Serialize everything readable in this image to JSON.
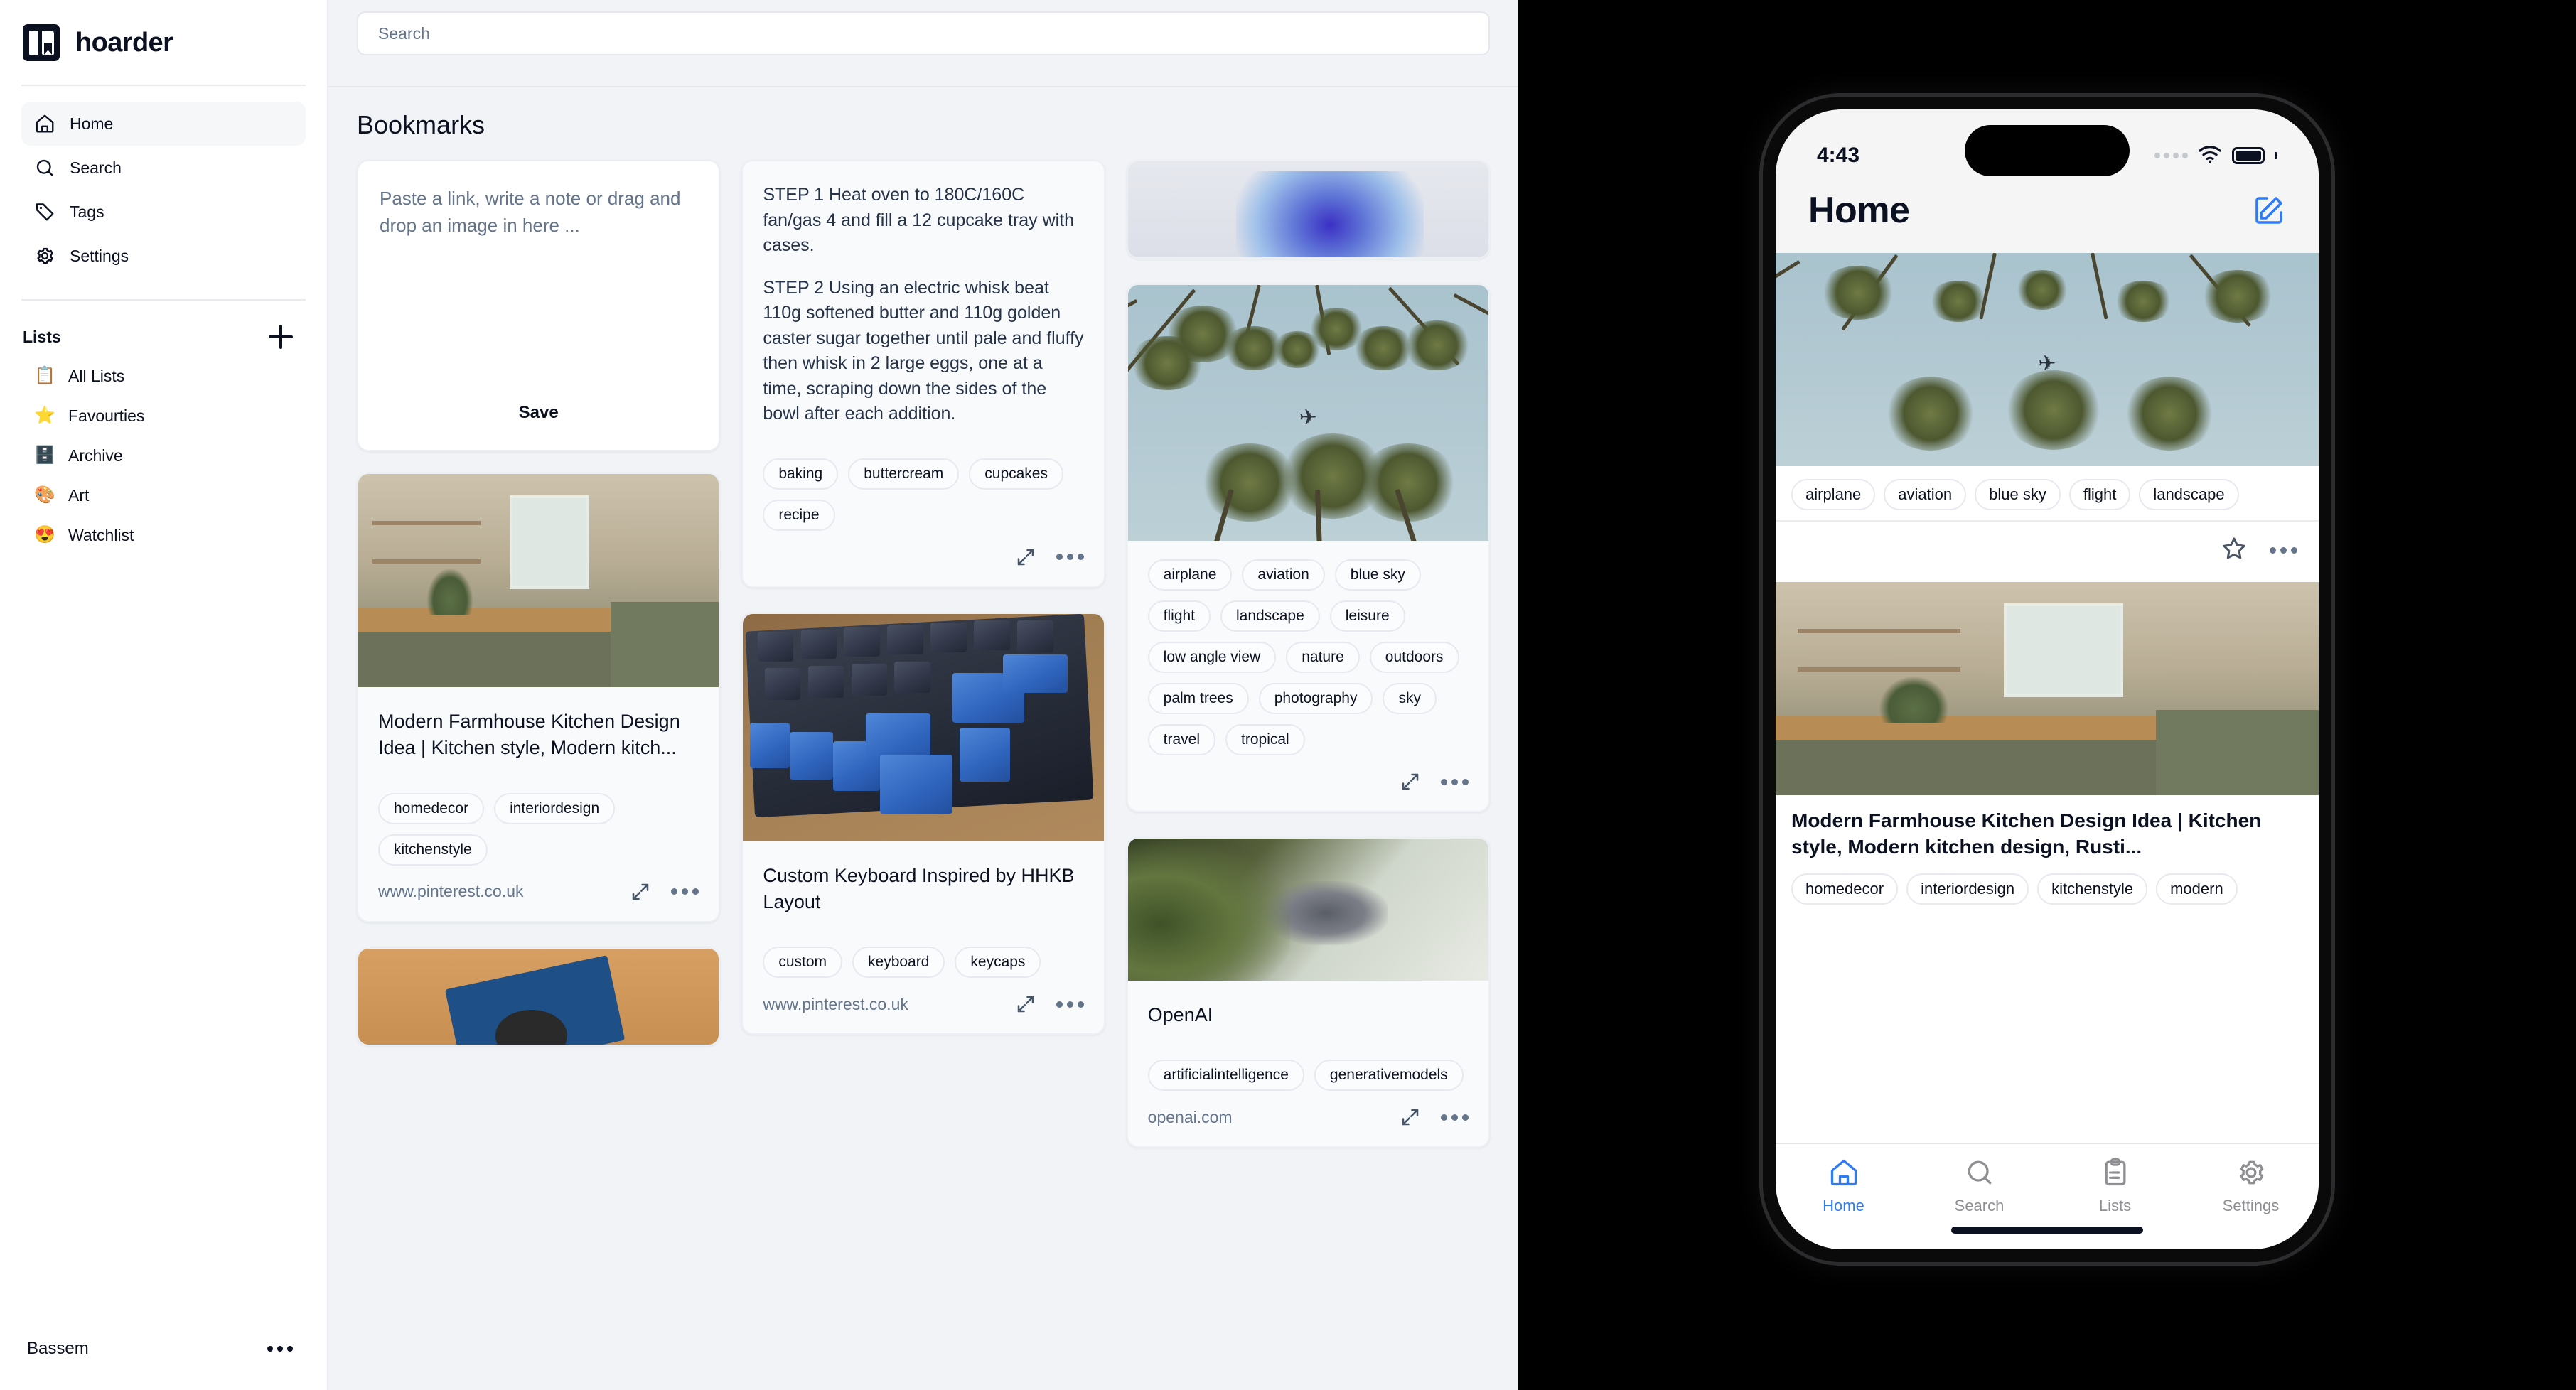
{
  "app": {
    "brand_name": "hoarder",
    "user_name": "Bassem"
  },
  "sidebar": {
    "nav": [
      {
        "label": "Home",
        "icon": "home-icon",
        "active": true
      },
      {
        "label": "Search",
        "icon": "search-icon",
        "active": false
      },
      {
        "label": "Tags",
        "icon": "tag-icon",
        "active": false
      },
      {
        "label": "Settings",
        "icon": "gear-icon",
        "active": false
      }
    ],
    "lists_title": "Lists",
    "add_list_label": "+",
    "lists": [
      {
        "label": "All Lists",
        "emoji": "📋"
      },
      {
        "label": "Favourties",
        "emoji": "⭐"
      },
      {
        "label": "Archive",
        "emoji": "🗄️"
      },
      {
        "label": "Art",
        "emoji": "🎨"
      },
      {
        "label": "Watchlist",
        "emoji": "😍"
      }
    ]
  },
  "main": {
    "search_placeholder": "Search",
    "page_title": "Bookmarks",
    "editor": {
      "placeholder": "Paste a link, write a note or drag and drop an image in here ...",
      "save_label": "Save"
    },
    "cards": [
      {
        "id": "recipe-note",
        "type": "note",
        "paragraphs": [
          "STEP 1 Heat oven to 180C/160C fan/gas 4 and fill a 12 cupcake tray with cases.",
          "STEP 2 Using an electric whisk beat 110g softened butter and 110g golden caster sugar together until pale and fluffy then whisk in 2 large eggs, one at a time, scraping down the sides of the bowl after each addition."
        ],
        "tags": [
          "baking",
          "buttercream",
          "cupcakes",
          "recipe"
        ],
        "url": ""
      },
      {
        "id": "palm-trees",
        "type": "image",
        "image_alt": "low angle view of palm trees with airplane in blue sky",
        "title": "",
        "tags": [
          "airplane",
          "aviation",
          "blue sky",
          "flight",
          "landscape",
          "leisure",
          "low angle view",
          "nature",
          "outdoors",
          "palm trees",
          "photography",
          "sky",
          "travel",
          "tropical"
        ],
        "url": ""
      },
      {
        "id": "farmhouse-kitchen",
        "type": "link",
        "image_alt": "modern farmhouse kitchen with green cabinets and wood counter",
        "title": "Modern Farmhouse Kitchen Design Idea | Kitchen style, Modern kitch...",
        "tags": [
          "homedecor",
          "interiordesign",
          "kitchenstyle"
        ],
        "url": "www.pinterest.co.uk"
      },
      {
        "id": "custom-keyboard",
        "type": "link",
        "image_alt": "mechanical keyboard with blue keycaps on wood desk",
        "title": "Custom Keyboard Inspired by HHKB Layout",
        "tags": [
          "custom",
          "keyboard",
          "keycaps"
        ],
        "url": "www.pinterest.co.uk"
      },
      {
        "id": "openai",
        "type": "link",
        "image_alt": "people talking in a plant filled office",
        "title": "OpenAI",
        "tags": [
          "artificialintelligence",
          "generativemodels"
        ],
        "url": "openai.com"
      },
      {
        "id": "circuit-board",
        "type": "image",
        "image_alt": "blue circuit board with fan on wooden surface",
        "title": "",
        "tags": [],
        "url": ""
      },
      {
        "id": "blue-crystal",
        "type": "image",
        "image_alt": "blue crystal sculpture on white wall",
        "title": "",
        "tags": [],
        "url": ""
      }
    ]
  },
  "phone": {
    "status": {
      "time": "4:43"
    },
    "header": {
      "title": "Home",
      "compose_icon": "compose-icon"
    },
    "cards": [
      {
        "id": "palm-trees-mobile",
        "image_alt": "low angle view of palm trees with airplane in blue sky",
        "title": "",
        "tags": [
          "airplane",
          "aviation",
          "blue sky",
          "flight",
          "landscape"
        ]
      },
      {
        "id": "farmhouse-kitchen-mobile",
        "image_alt": "modern farmhouse kitchen with green cabinets and wood counter",
        "title": "Modern Farmhouse Kitchen Design Idea | Kitchen style, Modern kitchen design, Rusti...",
        "tags": [
          "homedecor",
          "interiordesign",
          "kitchenstyle",
          "modern"
        ]
      }
    ],
    "tabs": [
      {
        "label": "Home",
        "icon": "home-icon",
        "active": true
      },
      {
        "label": "Search",
        "icon": "search-icon",
        "active": false
      },
      {
        "label": "Lists",
        "icon": "clipboard-icon",
        "active": false
      },
      {
        "label": "Settings",
        "icon": "gear-icon",
        "active": false
      }
    ]
  },
  "colors": {
    "accent_blue": "#2f7bf6",
    "ink": "#0b1120",
    "muted": "#64748b",
    "canvas": "#f1f3f6"
  }
}
